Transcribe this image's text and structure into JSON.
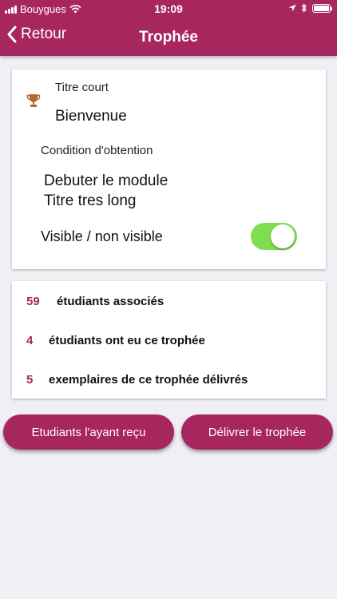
{
  "status": {
    "carrier": "Bouygues",
    "time": "19:09",
    "icons": [
      "signal-icon",
      "wifi-icon",
      "location-icon",
      "bluetooth-icon",
      "battery-icon"
    ]
  },
  "nav": {
    "back_label": "Retour",
    "title": "Trophée"
  },
  "trophy": {
    "icon": "trophy-icon",
    "short_title_label": "Titre court",
    "short_title_value": "Bienvenue",
    "condition_label": "Condition d'obtention",
    "condition_lines": [
      "Debuter le module",
      "Titre tres long"
    ],
    "visibility_label": "Visible / non visible",
    "visible": true
  },
  "stats": [
    {
      "value": "59",
      "label": "étudiants associés"
    },
    {
      "value": "4",
      "label": "étudiants ont eu ce trophée"
    },
    {
      "value": "5",
      "label": "exemplaires de ce trophée délivrés"
    }
  ],
  "actions": {
    "received_button": "Etudiants l'ayant reçu",
    "deliver_button": "Délivrer le trophée"
  },
  "colors": {
    "brand": "#a8265e",
    "toggle_on": "#7ede52",
    "background": "#efeff4"
  }
}
